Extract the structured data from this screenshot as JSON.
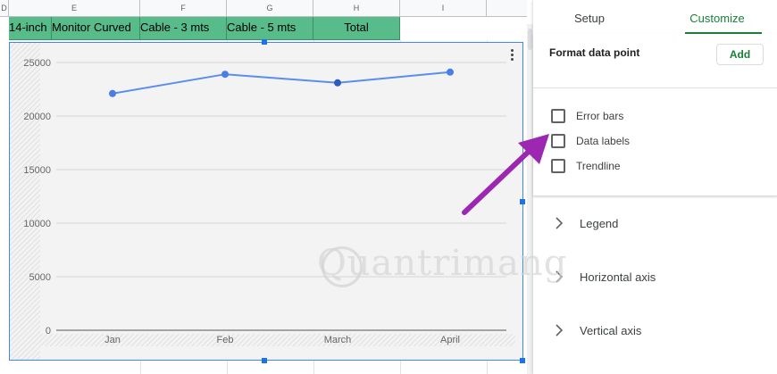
{
  "sheet": {
    "columns": [
      "D",
      "E",
      "F",
      "G",
      "H",
      "I"
    ],
    "header_cells": [
      "14-inch",
      "Monitor Curved",
      "Cable - 3 mts",
      "Cable - 5 mts",
      "Total"
    ]
  },
  "chart_data": {
    "type": "line",
    "categories": [
      "Jan",
      "Feb",
      "March",
      "April"
    ],
    "series": [
      {
        "values": [
          22100,
          23900,
          23100,
          24100
        ]
      }
    ],
    "ylim": [
      0,
      25000
    ],
    "yticks": [
      "0",
      "5000",
      "10000",
      "15000",
      "20000",
      "25000"
    ],
    "grid": true,
    "colors": {
      "line": "#5b8def",
      "point": "#4a7ee6",
      "selected_point": "#2e5cb8"
    }
  },
  "panel": {
    "tabs": {
      "setup": "Setup",
      "customize": "Customize"
    },
    "format_data_point": "Format data point",
    "add_label": "Add",
    "checkboxes": [
      {
        "label": "Error bars",
        "checked": false
      },
      {
        "label": "Data labels",
        "checked": false
      },
      {
        "label": "Trendline",
        "checked": false
      }
    ],
    "sections": [
      "Legend",
      "Horizontal axis",
      "Vertical axis"
    ]
  },
  "colors": {
    "accent_green": "#188038",
    "header_green": "#57bb8a",
    "selection_blue": "#1a73e8",
    "arrow_purple": "#9c27b0"
  },
  "watermark": "Quantrimang",
  "icons": [
    "more-vert-icon",
    "chevron-right-icon",
    "arrow-annotation-icon"
  ]
}
